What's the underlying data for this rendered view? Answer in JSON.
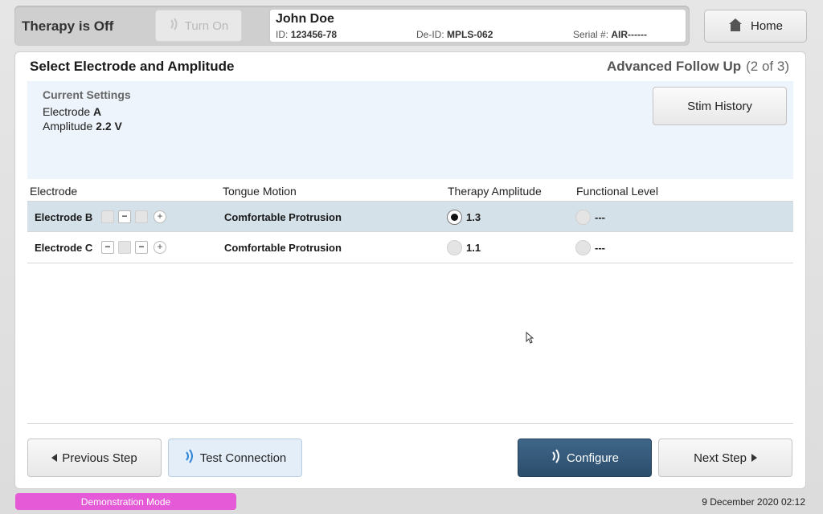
{
  "header": {
    "therapy_status": "Therapy is Off",
    "turn_on_label": "Turn On",
    "patient": {
      "name": "John Doe",
      "id_label": "ID:",
      "id_value": "123456-78",
      "deid_label": "De-ID:",
      "deid_value": "MPLS-062",
      "serial_label": "Serial #:",
      "serial_value": "AIR------"
    },
    "home_label": "Home"
  },
  "main": {
    "title": "Select Electrode and Amplitude",
    "step_name": "Advanced Follow Up",
    "step_count": "(2  of  3)",
    "current_settings": {
      "heading": "Current Settings",
      "electrode_label": "Electrode",
      "electrode_value": "A",
      "amplitude_label": "Amplitude",
      "amplitude_value": "2.2 V"
    },
    "stim_history_label": "Stim History",
    "table": {
      "columns": [
        "Electrode",
        "Tongue Motion",
        "Therapy Amplitude",
        "Functional Level"
      ],
      "rows": [
        {
          "electrode": "Electrode B",
          "motion": "Comfortable Protrusion",
          "amplitude": "1.3",
          "level": "---",
          "selected": true
        },
        {
          "electrode": "Electrode C",
          "motion": "Comfortable Protrusion",
          "amplitude": "1.1",
          "level": "---",
          "selected": false
        }
      ]
    },
    "buttons": {
      "previous": "Previous Step",
      "test_connection": "Test Connection",
      "configure": "Configure",
      "next": "Next Step"
    }
  },
  "footer": {
    "mode": "Demonstration Mode",
    "timestamp": "9 December 2020 02:12"
  },
  "colors": {
    "accent_dark": "#2c4d6c",
    "selected_row": "#d4e1e9",
    "demo_badge": "#e55ad6",
    "settings_bg": "#eef4fb"
  }
}
